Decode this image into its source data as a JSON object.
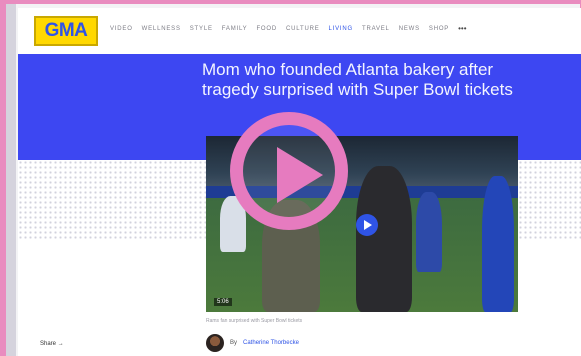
{
  "nav": {
    "logo": "GMA",
    "items": [
      "VIDEO",
      "WELLNESS",
      "STYLE",
      "FAMILY",
      "FOOD",
      "CULTURE",
      "LIVING",
      "TRAVEL",
      "NEWS",
      "SHOP"
    ],
    "active_item": "LIVING",
    "more": "•••"
  },
  "article": {
    "headline": "Mom who founded Atlanta bakery after tragedy surprised with Super Bowl tickets",
    "video_duration": "5:06",
    "caption": "Rams fan surprised with Super Bowl tickets",
    "share_label": "Share",
    "byline_prefix": "By",
    "author": "Catherine Thorbecke"
  },
  "colors": {
    "brand_blue": "#3d47f2",
    "logo_yellow": "#ffd800",
    "overlay_pink": "#e67bbf",
    "link_blue": "#2f54e6"
  }
}
